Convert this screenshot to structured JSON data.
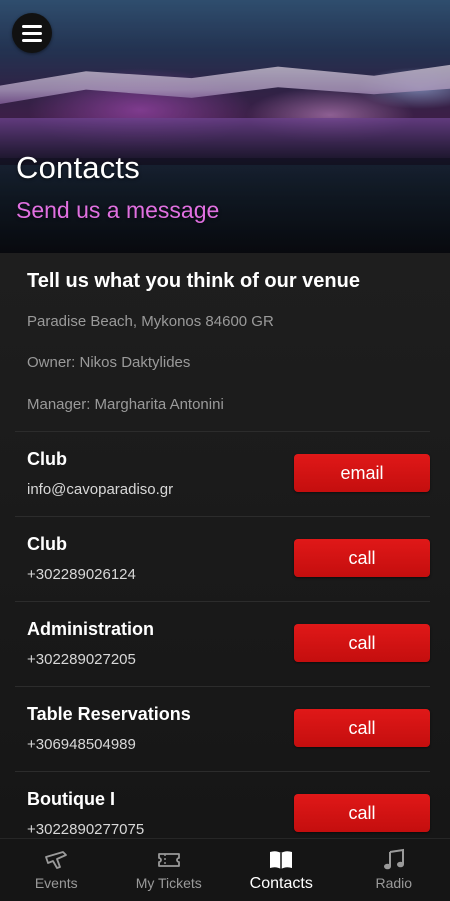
{
  "header": {
    "title": "Contacts",
    "subtitle_link": "Send us a message"
  },
  "venue": {
    "heading": "Tell us what you think of our venue",
    "address": "Paradise Beach, Mykonos 84600 GR",
    "owner": "Owner: Nikos Daktylides",
    "manager": "Manager: Margharita Antonini"
  },
  "contacts": [
    {
      "name": "Club",
      "value": "info@cavoparadiso.gr",
      "action": "email"
    },
    {
      "name": "Club",
      "value": "+302289026124",
      "action": "call"
    },
    {
      "name": "Administration",
      "value": "+302289027205",
      "action": "call"
    },
    {
      "name": "Table Reservations",
      "value": "+306948504989",
      "action": "call"
    },
    {
      "name": "Boutique I",
      "value": "+3022890277075",
      "action": "call"
    }
  ],
  "nav": {
    "items": [
      {
        "label": "Events",
        "icon": "events-icon",
        "active": false
      },
      {
        "label": "My Tickets",
        "icon": "ticket-icon",
        "active": false
      },
      {
        "label": "Contacts",
        "icon": "book-icon",
        "active": true
      },
      {
        "label": "Radio",
        "icon": "music-note-icon",
        "active": false
      }
    ]
  },
  "colors": {
    "accent": "#d41414",
    "link": "#e070e0",
    "background": "#101010"
  }
}
